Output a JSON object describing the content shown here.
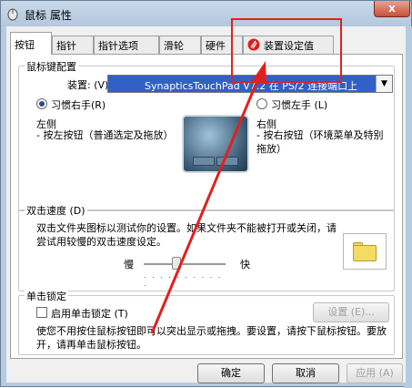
{
  "window": {
    "title": "鼠标 属性",
    "close_glyph": "x"
  },
  "tabs": [
    {
      "label": "按钮"
    },
    {
      "label": "指针"
    },
    {
      "label": "指针选项"
    },
    {
      "label": "滑轮"
    },
    {
      "label": "硬件"
    },
    {
      "label": "装置设定值"
    }
  ],
  "button_config": {
    "group_title": "鼠标键配置",
    "device_label": "装置:  (V)",
    "device_value": "SynapticsTouchPad V7.2 在 PS/2 连接端口上",
    "right_hand_label": "习惯右手(R)",
    "left_hand_label": "习惯左手 (L)",
    "left_side_title": "左侧",
    "left_side_desc": "- 按左按钮（普通选定及拖放）",
    "right_side_title": "右侧",
    "right_side_desc": "- 按右按钮（环境菜单及特别拖放）"
  },
  "double_click": {
    "group_title": "双击速度 (D)",
    "desc": "双击文件夹图标以测试你的设置。如果文件夹不能被打开或关闭，请尝试用较慢的双击速度设定。",
    "slow_label": "慢",
    "fast_label": "快",
    "speed_level": 0.4
  },
  "click_lock": {
    "group_title": "单击锁定",
    "checkbox_label": "启用单击锁定 (T)",
    "settings_button": "设置 (E)...",
    "desc": "使您不用按住鼠标按钮即可以突出显示或拖拽。要设置，请按下鼠标按钮。要放开，请再单击鼠标按钮。"
  },
  "footer": {
    "ok": "确定",
    "cancel": "取消",
    "apply": "应用 (A)"
  },
  "colors": {
    "annotation_red": "#e02020",
    "selection_blue": "#3060c8"
  }
}
